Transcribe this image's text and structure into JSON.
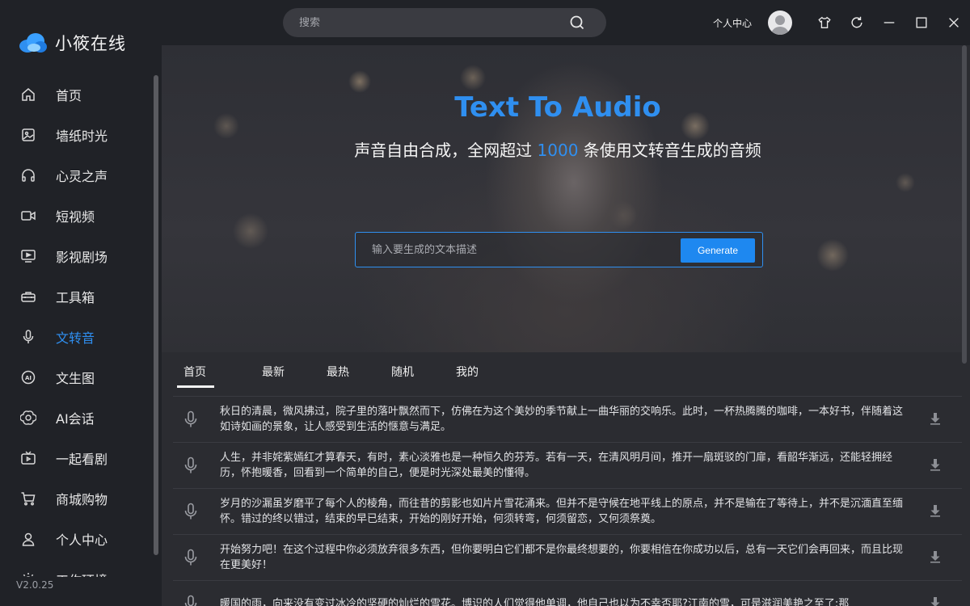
{
  "app": {
    "name": "小筱在线",
    "version": "V2.0.25"
  },
  "sidebar": {
    "items": [
      {
        "label": "首页",
        "icon": "home-icon",
        "active": false
      },
      {
        "label": "墙纸时光",
        "icon": "image-icon",
        "active": false
      },
      {
        "label": "心灵之声",
        "icon": "headphones-icon",
        "active": false
      },
      {
        "label": "短视频",
        "icon": "video-camera-icon",
        "active": false
      },
      {
        "label": "影视剧场",
        "icon": "tv-play-icon",
        "active": false
      },
      {
        "label": "工具箱",
        "icon": "toolbox-icon",
        "active": false
      },
      {
        "label": "文转音",
        "icon": "microphone-icon",
        "active": true
      },
      {
        "label": "文生图",
        "icon": "ai-badge-icon",
        "active": false
      },
      {
        "label": "AI会话",
        "icon": "openai-icon",
        "active": false
      },
      {
        "label": "一起看剧",
        "icon": "tv-icon",
        "active": false
      },
      {
        "label": "商城购物",
        "icon": "cart-icon",
        "active": false
      },
      {
        "label": "个人中心",
        "icon": "user-icon",
        "active": false
      },
      {
        "label": "工作环境",
        "icon": "settings-icon",
        "active": false
      }
    ]
  },
  "titlebar": {
    "search_placeholder": "搜索",
    "user_center": "个人中心"
  },
  "hero": {
    "title": "Text To Audio",
    "subtitle_before": "声音自由合成，全网超过 ",
    "subtitle_number": "1000",
    "subtitle_after": " 条使用文转音生成的音频",
    "input_placeholder": "输入要生成的文本描述",
    "generate_label": "Generate"
  },
  "tabs": [
    "首页",
    "最新",
    "最热",
    "随机",
    "我的"
  ],
  "list": [
    {
      "text": "秋日的清晨，微风拂过，院子里的落叶飘然而下，仿佛在为这个美妙的季节献上一曲华丽的交响乐。此时，一杯热腾腾的咖啡，一本好书，伴随着这如诗如画的景象，让人感受到生活的惬意与满足。"
    },
    {
      "text": "人生，并非姹紫嫣红才算春天，有时，素心淡雅也是一种恒久的芬芳。若有一天，在清风明月间，推开一扇斑驳的门扉，看韶华渐远，还能轻拥经历，怀抱暖香，回看到一个简单的自己，便是时光深处最美的懂得。"
    },
    {
      "text": "岁月的沙漏虽岁磨平了每个人的棱角，而往昔的剪影也如片片雪花涌来。但并不是守候在地平线上的原点，并不是输在了等待上，并不是沉湎直至缅怀。错过的终以错过，结束的早已结束，开始的刚好开始，何须转弯，何须留恋，又何须祭奠。"
    },
    {
      "text": "开始努力吧！在这个过程中你必须放弃很多东西，但你要明白它们都不是你最终想要的，你要相信在你成功以后，总有一天它们会再回来，而且比现在更美好！"
    },
    {
      "text": "暖国的雨，向来没有变过冰冷的坚硬的灿烂的雪花。博识的人们觉得他单调，他自己也以为不幸否耶?江南的雪，可是滋润美艳之至了;那"
    }
  ]
}
